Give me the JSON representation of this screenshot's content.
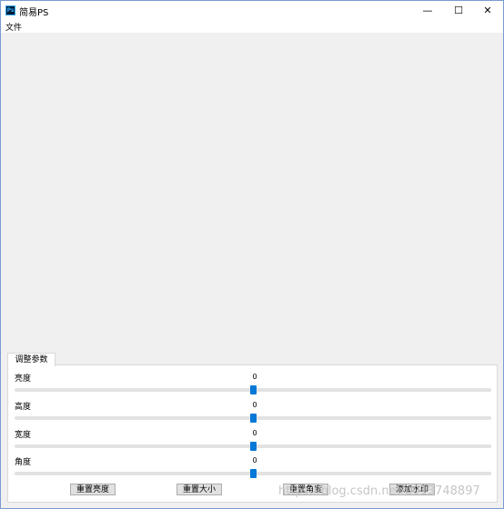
{
  "window": {
    "title": "简易PS",
    "app_icon_text": "Ps",
    "controls": {
      "minimize": "—",
      "maximize": "☐",
      "close": "✕"
    }
  },
  "menu": {
    "file": "文件"
  },
  "panel": {
    "tab_label": "调整参数",
    "params": [
      {
        "label": "亮度",
        "value": "0",
        "level": 0.5
      },
      {
        "label": "高度",
        "value": "0",
        "level": 0.5
      },
      {
        "label": "宽度",
        "value": "0",
        "level": 0.5
      },
      {
        "label": "角度",
        "value": "0",
        "level": 0.5
      }
    ],
    "buttons": {
      "reset_brightness": "重置亮度",
      "reset_size": "重置大小",
      "reset_angle": "重置角度",
      "add_watermark": "添加水印"
    }
  },
  "watermark_text": "https://blog.csdn.net/u013748897",
  "colors": {
    "accent": "#0078d7",
    "track": "#e2e2e2",
    "background": "#f0f0f0"
  }
}
